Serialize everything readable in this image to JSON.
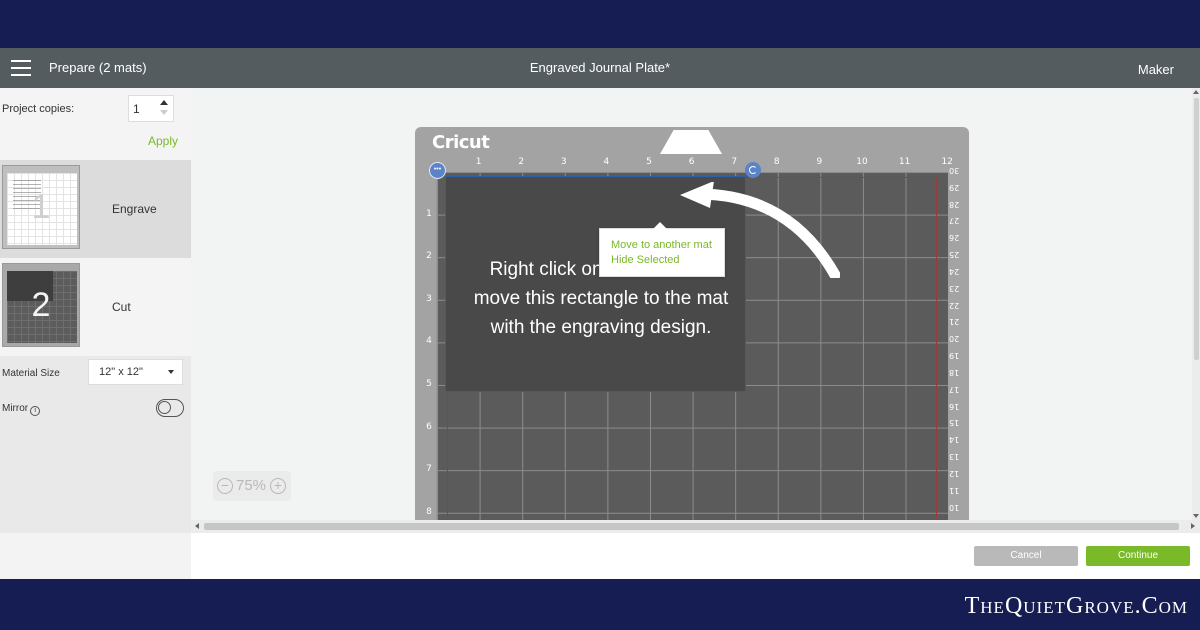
{
  "header": {
    "menu_icon": "hamburger-menu-icon",
    "prepare": "Prepare (2 mats)",
    "title": "Engraved Journal Plate*",
    "machine": "Maker"
  },
  "sidebar": {
    "copies_label": "Project copies:",
    "copies_value": "1",
    "apply": "Apply",
    "mats": [
      {
        "number": "1",
        "label": "Engrave"
      },
      {
        "number": "2",
        "label": "Cut"
      }
    ],
    "material_size_label": "Material Size",
    "material_size_value": "12\" x 12\"",
    "mirror_label": "Mirror",
    "mirror_info": "i"
  },
  "mat": {
    "brand": "Cricut",
    "ruler_top": [
      "1",
      "2",
      "3",
      "4",
      "5",
      "6",
      "7",
      "8",
      "9",
      "10",
      "11",
      "12"
    ],
    "ruler_left": [
      "1",
      "2",
      "3",
      "4",
      "5",
      "6",
      "7",
      "8"
    ],
    "ruler_right": [
      "30",
      "29",
      "28",
      "27",
      "26",
      "25",
      "24",
      "23",
      "22",
      "21",
      "20",
      "19",
      "18",
      "17",
      "16",
      "15",
      "14",
      "13",
      "12",
      "11",
      "10"
    ]
  },
  "selection": {
    "dots": "•••",
    "instruction": "Right click on the 3 dots to move this rectangle to the mat with the engraving design."
  },
  "context_menu": {
    "items": [
      "Move to another mat",
      "Hide Selected"
    ]
  },
  "zoom": {
    "minus": "−",
    "value": "75%",
    "plus": "+"
  },
  "footer": {
    "cancel": "Cancel",
    "continue": "Continue"
  },
  "watermark": "TheQuietGrove.Com",
  "colors": {
    "accent": "#7ab928",
    "header": "#555c60",
    "selection_handle": "#5b83c7",
    "band": "#151d52"
  }
}
